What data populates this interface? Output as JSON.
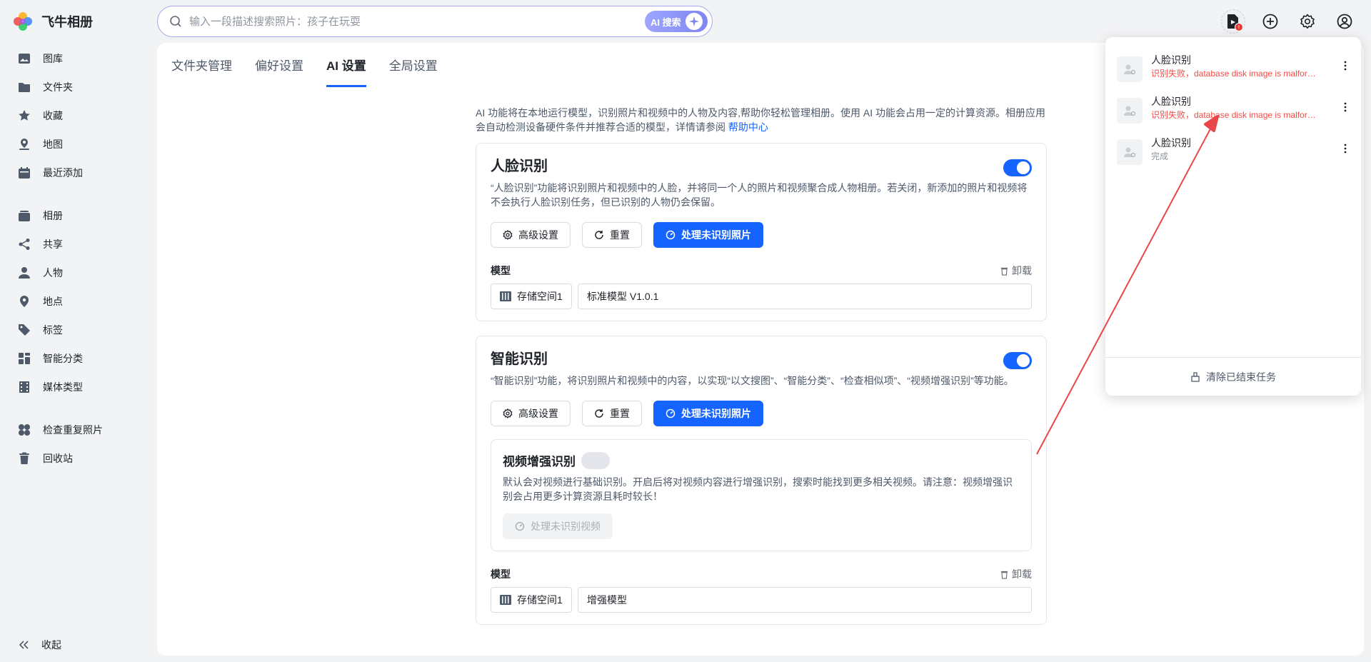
{
  "app": {
    "name": "飞牛相册"
  },
  "search": {
    "placeholder": "输入一段描述搜索照片：孩子在玩耍",
    "ai_label": "AI 搜索"
  },
  "sidebar": {
    "items": [
      {
        "label": "图库",
        "icon": "image-icon"
      },
      {
        "label": "文件夹",
        "icon": "folder-icon"
      },
      {
        "label": "收藏",
        "icon": "star-icon"
      },
      {
        "label": "地图",
        "icon": "map-pin-icon"
      },
      {
        "label": "最近添加",
        "icon": "calendar-icon"
      }
    ],
    "items2": [
      {
        "label": "相册",
        "icon": "album-icon"
      },
      {
        "label": "共享",
        "icon": "share-icon"
      },
      {
        "label": "人物",
        "icon": "person-icon"
      },
      {
        "label": "地点",
        "icon": "location-icon"
      },
      {
        "label": "标签",
        "icon": "tag-icon"
      },
      {
        "label": "智能分类",
        "icon": "grid-icon"
      },
      {
        "label": "媒体类型",
        "icon": "film-icon"
      }
    ],
    "items3": [
      {
        "label": "检查重复照片",
        "icon": "duplicate-icon"
      },
      {
        "label": "回收站",
        "icon": "trash-icon"
      }
    ],
    "collapse_label": "收起"
  },
  "tabs": [
    {
      "label": "文件夹管理",
      "active": false
    },
    {
      "label": "偏好设置",
      "active": false
    },
    {
      "label": "AI 设置",
      "active": true
    },
    {
      "label": "全局设置",
      "active": false
    }
  ],
  "intro": {
    "text": "AI 功能将在本地运行模型，识别照片和视频中的人物及内容,帮助你轻松管理相册。使用 AI 功能会占用一定的计算资源。相册应用会自动检测设备硬件条件并推荐合适的模型，详情请参阅",
    "link": "帮助中心"
  },
  "face": {
    "title": "人脸识别",
    "enabled": true,
    "desc": "“人脸识别”功能将识别照片和视频中的人脸，并将同一个人的照片和视频聚合成人物相册。若关闭，新添加的照片和视频将不会执行人脸识别任务，但已识别的人物仍会保留。",
    "btn_advanced": "高级设置",
    "btn_reset": "重置",
    "btn_process": "处理未识别照片",
    "model_label": "模型",
    "unload": "卸载",
    "storage": "存储空间1",
    "model": "标准模型 V1.0.1"
  },
  "smart": {
    "title": "智能识别",
    "enabled": true,
    "desc": "“智能识别”功能，将识别照片和视频中的内容，以实现“以文搜图”、“智能分类”、“检查相似项”、“视频增强识别”等功能。",
    "btn_advanced": "高级设置",
    "btn_reset": "重置",
    "btn_process": "处理未识别照片",
    "video": {
      "title": "视频增强识别",
      "enabled": false,
      "desc": "默认会对视频进行基础识别。开启后将对视频内容进行增强识别，搜索时能找到更多相关视频。请注意：视频增强识别会占用更多计算资源且耗时较长！",
      "btn": "处理未识别视频"
    },
    "model_label": "模型",
    "unload": "卸载",
    "storage": "存储空间1",
    "model": "增强模型"
  },
  "tasks": {
    "items": [
      {
        "name": "人脸识别",
        "status": "识别失败，database disk image is malformed",
        "state": "failed"
      },
      {
        "name": "人脸识别",
        "status": "识别失败，database disk image is malformed",
        "state": "failed"
      },
      {
        "name": "人脸识别",
        "status": "完成",
        "state": "done"
      }
    ],
    "clear_label": "清除已结束任务",
    "badge": "!"
  },
  "colors": {
    "primary": "#1664ff",
    "error": "#f54a45",
    "annotation": "#e8474a"
  }
}
